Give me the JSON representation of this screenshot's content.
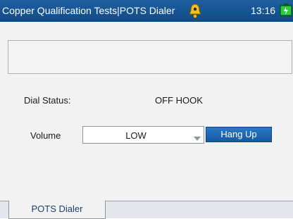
{
  "titlebar": {
    "title": "Copper Qualification Tests|POTS Dialer",
    "time": "13:16",
    "icons": {
      "alarm": "alarm-bell-icon",
      "battery": "battery-icon"
    },
    "colors": {
      "background": "#1f5fa0",
      "text": "#ffffff"
    }
  },
  "dial_status": {
    "label": "Dial Status:",
    "value": "OFF HOOK"
  },
  "volume": {
    "label": "Volume",
    "selected": "LOW"
  },
  "buttons": {
    "hang_up": "Hang Up"
  },
  "tabs": [
    {
      "label": "POTS Dialer",
      "active": true
    }
  ],
  "colors": {
    "accent": "#1a6bbd",
    "battery": "#2ecc40"
  }
}
